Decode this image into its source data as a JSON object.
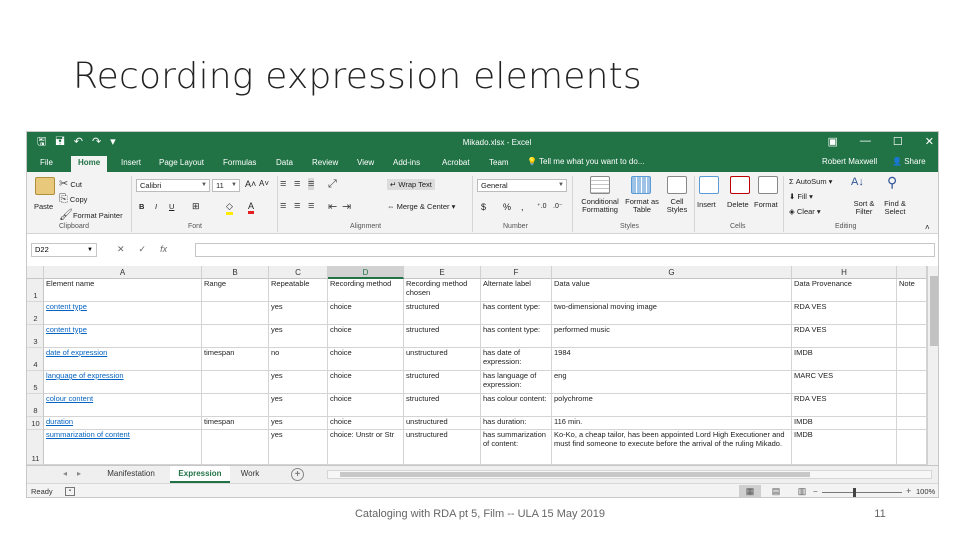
{
  "slide": {
    "title": "Recording expression elements",
    "footer": "Cataloging with RDA pt 5, Film -- ULA 15 May 2019",
    "page_number": "11"
  },
  "window": {
    "title": "Mikado.xlsx - Excel",
    "controls": [
      "▣",
      "—",
      "☐",
      "✕"
    ],
    "accent_color": "#217346"
  },
  "ribbon_tabs": [
    "File",
    "Home",
    "Insert",
    "Page Layout",
    "Formulas",
    "Data",
    "Review",
    "View",
    "Add-ins",
    "Acrobat",
    "Team"
  ],
  "active_tab": "Home",
  "tell_me": "Tell me what you want to do...",
  "user": "Robert Maxwell",
  "share": "Share",
  "ribbon": {
    "clipboard": {
      "paste": "Paste",
      "cut": "Cut",
      "copy": "Copy",
      "format_painter": "Format Painter",
      "label": "Clipboard"
    },
    "font": {
      "name": "Calibri",
      "size": "11",
      "label": "Font",
      "bold": "B",
      "italic": "I",
      "underline": "U"
    },
    "alignment": {
      "wrap": "Wrap Text",
      "merge": "Merge & Center",
      "label": "Alignment"
    },
    "number": {
      "format": "General",
      "currency": "$",
      "percent": "%",
      "comma": ",",
      "label": "Number"
    },
    "styles": {
      "conditional": "Conditional Formatting",
      "format_table": "Format as Table",
      "cell_styles": "Cell Styles",
      "label": "Styles"
    },
    "cells": {
      "insert": "Insert",
      "delete": "Delete",
      "format": "Format",
      "label": "Cells"
    },
    "editing": {
      "autosum": "AutoSum",
      "fill": "Fill",
      "clear": "Clear",
      "sort": "Sort & Filter",
      "find": "Find & Select",
      "label": "Editing"
    }
  },
  "formula_bar": {
    "name_box": "D22",
    "cancel": "✕",
    "enter": "✓",
    "fx": "fx"
  },
  "columns": [
    "A",
    "B",
    "C",
    "D",
    "E",
    "F",
    "G",
    "H"
  ],
  "selected_column": "D",
  "rows": [
    {
      "num": "1",
      "cells": [
        "Element name",
        "Range",
        "Repeatable",
        "Recording method",
        "Recording method chosen",
        "Alternate label",
        "Data value",
        "Data Provenance",
        "Note"
      ]
    },
    {
      "num": "2",
      "cells": [
        "content type",
        "",
        "yes",
        "choice",
        "structured",
        "has content type:",
        "two-dimensional moving image",
        "RDA VES",
        ""
      ]
    },
    {
      "num": "3",
      "cells": [
        "content type",
        "",
        "yes",
        "choice",
        "structured",
        "has content type:",
        "performed music",
        "RDA VES",
        ""
      ]
    },
    {
      "num": "4",
      "cells": [
        "date of expression",
        "timespan",
        "no",
        "choice",
        "unstructured",
        "has date of expression:",
        "1984",
        "IMDB",
        ""
      ]
    },
    {
      "num": "5",
      "cells": [
        "language of expression",
        "",
        "yes",
        "choice",
        "structured",
        "has language of expression:",
        "eng",
        "MARC VES",
        ""
      ]
    },
    {
      "num": "8",
      "cells": [
        "colour content",
        "",
        "yes",
        "choice",
        "structured",
        "has colour content:",
        "polychrome",
        "RDA VES",
        ""
      ]
    },
    {
      "num": "10",
      "cells": [
        "duration",
        "timespan",
        "yes",
        "choice",
        "unstructured",
        "has duration:",
        "116 min.",
        "IMDB",
        ""
      ]
    },
    {
      "num": "11",
      "cells": [
        "summarization of content",
        "",
        "yes",
        "choice: Unstr or Str",
        "unstructured",
        "has summarization of content:",
        "Ko-Ko, a cheap tailor, has been appointed Lord High Executioner and must find someone to execute before the arrival of the ruling Mikado.",
        "IMDB",
        ""
      ]
    }
  ],
  "sheet_tabs": [
    "Manifestation",
    "Expression",
    "Work"
  ],
  "active_sheet": "Expression",
  "status": {
    "ready": "Ready",
    "zoom": "100%"
  }
}
